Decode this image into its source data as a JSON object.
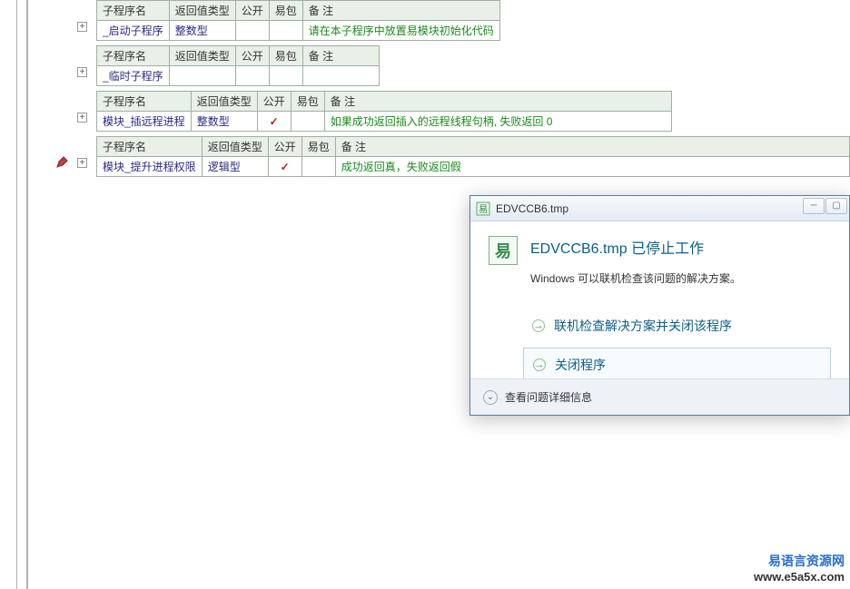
{
  "headers": {
    "name": "子程序名",
    "returnType": "返回值类型",
    "public": "公开",
    "easyPkg": "易包",
    "comment": "备 注"
  },
  "blocks": [
    {
      "name": "_启动子程序",
      "returnType": "整数型",
      "public": false,
      "easyPkg": false,
      "comment": "请在本子程序中放置易模块初始化代码",
      "widths": {
        "name": 78,
        "ret": 68,
        "pub": 32,
        "ep": 36,
        "cmt": 206
      }
    },
    {
      "name": "_临时子程序",
      "returnType": "",
      "public": false,
      "easyPkg": false,
      "comment": "",
      "widths": {
        "name": 78,
        "ret": 68,
        "pub": 32,
        "ep": 36,
        "cmt": 84
      }
    },
    {
      "name": "模块_插远程进程",
      "returnType": "整数型",
      "public": true,
      "easyPkg": false,
      "comment": "如果成功返回插入的远程线程句柄, 失败返回 0",
      "widths": {
        "name": 100,
        "ret": 68,
        "pub": 32,
        "ep": 36,
        "cmt": 382
      }
    },
    {
      "name": "模块_提升进程权限",
      "returnType": "逻辑型",
      "public": true,
      "easyPkg": false,
      "comment": "成功返回真，失败返回假",
      "hasPencil": true,
      "widths": {
        "name": 112,
        "ret": 68,
        "pub": 32,
        "ep": 36,
        "cmt": 588
      }
    }
  ],
  "dialog": {
    "title": "EDVCCB6.tmp",
    "heading": "EDVCCB6.tmp 已停止工作",
    "sub": "Windows 可以联机检查该问题的解决方案。",
    "optionOnline": "联机检查解决方案并关闭该程序",
    "optionClose": "关闭程序",
    "details": "查看问题详细信息"
  },
  "watermark": {
    "line1": "易语言资源网",
    "line2": "www.e5a5x.com"
  },
  "checkmark": "✓",
  "plus": "+"
}
